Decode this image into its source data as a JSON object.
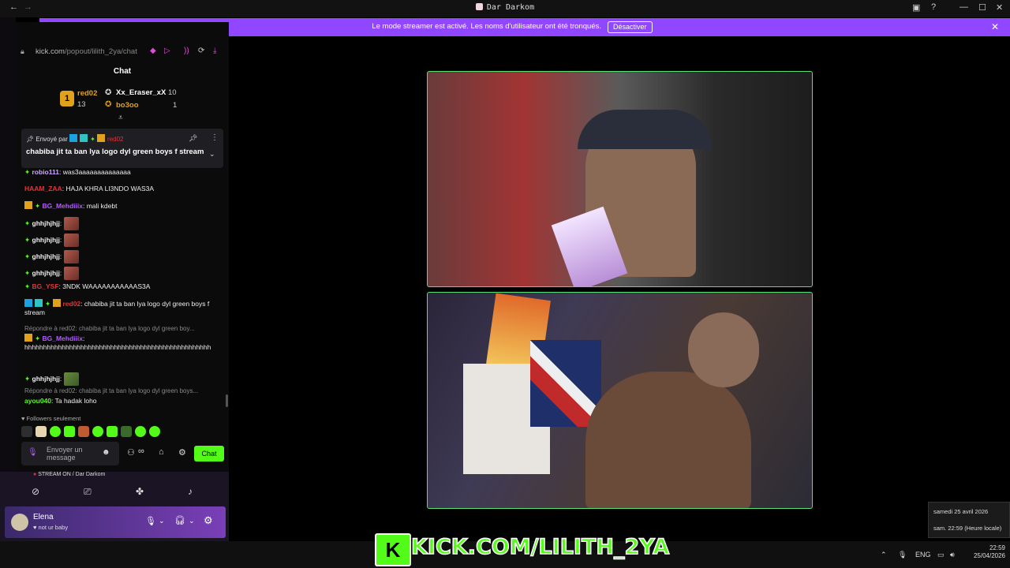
{
  "window": {
    "title": "Dar Darkom",
    "back": "←",
    "forward": "→"
  },
  "banner": {
    "message": "Le mode streamer est activé. Les noms d'utilisateur ont été tronqués.",
    "button": "Désactiver",
    "close": "✕"
  },
  "chat": {
    "url_host": "kick.com",
    "url_path": "/popout/lilith_2ya/chat",
    "title": "Chat",
    "leaderboard": [
      {
        "rank": "1",
        "name": "red02",
        "count": "13"
      },
      {
        "name": "Xx_Eraser_xX",
        "count": "10"
      },
      {
        "name": "bo3oo",
        "count": "1"
      }
    ],
    "pinned": {
      "sent_by": "Envoyé par",
      "user": "red02",
      "text": "chabiba jit ta ban lya logo dyl green boys f stream"
    },
    "messages": [
      {
        "user": "robio111",
        "text": "was3aaaaaaaaaaaaaa"
      },
      {
        "user": "HAAM_ZAA",
        "text": "HAJA KHRA LI3NDO WAS3A"
      },
      {
        "user": "BG_Mehdiiix",
        "text": "mali kdebt"
      },
      {
        "user": "ghhjhjhjj",
        "text": ""
      },
      {
        "user": "ghhjhjhjj",
        "text": ""
      },
      {
        "user": "ghhjhjhjj",
        "text": ""
      },
      {
        "user": "ghhjhjhjj",
        "text": ""
      },
      {
        "user": "BG_YSF",
        "text": "3NDK WAAAAAAAAAAAS3A"
      },
      {
        "user": "red02",
        "text": "chabiba jit ta ban lya logo dyl green boys f stream"
      },
      {
        "reply": "Répondre à red02: chabiba jit ta ban lya logo dyl green boy...",
        "user": "BG_Mehdiiix",
        "text": "hhhhhhhhhhhhhhhhhhhhhhhhhhhhhhhhhhhhhhhhhhhhhhhhhh"
      },
      {
        "user": "ghhjhjhjj",
        "text": ""
      },
      {
        "reply": "Répondre à red02: chabiba jit ta ban lya logo dyl green boys...",
        "user": "ayou040",
        "text": "Ta hadak loho"
      }
    ],
    "followers_only": "Followers seulement",
    "placeholder": "Envoyer un message",
    "send_label": "Chat"
  },
  "discord": {
    "stream_label": "STREAM ON / Dar Darkom",
    "user_name": "Elena",
    "user_status": "not ur baby"
  },
  "tooltip": {
    "date": "samedi 25 avril 2026",
    "time": "sam. 22:59 (Heure locale)"
  },
  "taskbar": {
    "lang": "ENG",
    "time": "22:59",
    "date": "25/04/2026"
  },
  "overlay": {
    "kick_url": "KICK.COM/LILITH_2YA"
  },
  "colors": {
    "kick_green": "#53fc18",
    "banner_purple": "#9147ff",
    "cam_border": "#58e07a"
  }
}
